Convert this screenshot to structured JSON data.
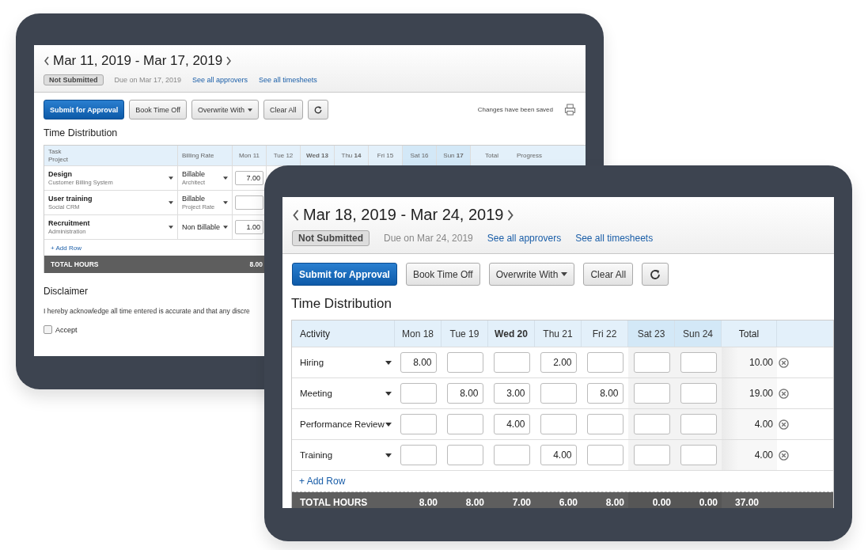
{
  "back_window": {
    "title": "Mar 11, 2019 - Mar 17, 2019",
    "status": "Not Submitted",
    "due": "Due on Mar 17, 2019",
    "links": [
      "See all approvers",
      "See all timesheets"
    ],
    "buttons": [
      {
        "label": "Submit for Approval",
        "kind": "primary"
      },
      {
        "label": "Book Time Off",
        "kind": "plain"
      },
      {
        "label": "Overwrite With",
        "kind": "dropdown"
      },
      {
        "label": "Clear All",
        "kind": "plain"
      },
      {
        "kind": "refresh"
      }
    ],
    "save_status": "Changes have been saved",
    "section_title": "Time Distribution",
    "columns": [
      {
        "label": "Task",
        "sub": "Project",
        "kind": "task"
      },
      {
        "label": "Billing Rate",
        "kind": "rate"
      },
      {
        "label": "Mon 11",
        "kind": "day",
        "weekend": false
      },
      {
        "label": "Tue 12",
        "kind": "day",
        "weekend": false
      },
      {
        "label": "**Wed 13**",
        "kind": "day",
        "weekend": false
      },
      {
        "label": "Thu **14**",
        "kind": "day",
        "weekend": false
      },
      {
        "label": "Fri 15",
        "kind": "day",
        "weekend": false
      },
      {
        "label": "Sat 16",
        "kind": "day",
        "weekend": true
      },
      {
        "label": "Sun **17**",
        "kind": "day",
        "weekend": true
      },
      {
        "label": "Total",
        "kind": "total"
      },
      {
        "label": "Progress",
        "kind": "progress"
      }
    ],
    "rows": [
      {
        "task": "Design",
        "project": "Customer Billing System",
        "rate": "Billable",
        "rate_detail": "Architect",
        "mon": "7.00"
      },
      {
        "task": "User training",
        "project": "Social CRM",
        "rate": "Billable",
        "rate_detail": "Project Rate"
      },
      {
        "task": "Recruitment",
        "project": "Administration",
        "rate": "Non Billable",
        "mon": "1.00"
      }
    ],
    "add_row": "+ Add Row",
    "total_label": "TOTAL HOURS",
    "total_mon": "8.00",
    "disclaimer_title": "Disclaimer",
    "disclaimer_text": "I hereby acknowledge all time entered is accurate and that any discre",
    "accept": {
      "label": "Accept",
      "checked": false
    }
  },
  "front_window": {
    "title": "Mar 18, 2019 - Mar 24, 2019",
    "status": "Not Submitted",
    "due": "Due on Mar 24, 2019",
    "links": [
      "See all approvers",
      "See all timesheets"
    ],
    "buttons": [
      {
        "label": "Submit for Approval",
        "kind": "primary"
      },
      {
        "label": "Book Time Off",
        "kind": "plain"
      },
      {
        "label": "Overwrite With",
        "kind": "dropdown"
      },
      {
        "label": "Clear All",
        "kind": "plain"
      },
      {
        "kind": "refresh"
      }
    ],
    "section_title": "Time Distribution",
    "activity_header": "Activity",
    "days": [
      {
        "label": "Mon 18",
        "today": false,
        "weekend": false
      },
      {
        "label": "Tue 19",
        "today": false,
        "weekend": false
      },
      {
        "label": "Wed 20",
        "today": true,
        "weekend": false
      },
      {
        "label": "Thu 21",
        "today": false,
        "weekend": false
      },
      {
        "label": "Fri 22",
        "today": false,
        "weekend": false
      },
      {
        "label": "Sat 23",
        "today": false,
        "weekend": true
      },
      {
        "label": "Sun 24",
        "today": false,
        "weekend": true
      }
    ],
    "total_header": "Total",
    "rows": [
      {
        "activity": "Hiring",
        "hours": {
          "mon": "8.00",
          "thu": "2.00"
        },
        "total": "10.00"
      },
      {
        "activity": "Meeting",
        "hours": {
          "tue": "8.00",
          "wed": "3.00",
          "fri": "8.00"
        },
        "total": "19.00"
      },
      {
        "activity": "Performance Review",
        "hours": {
          "wed": "4.00"
        },
        "total": "4.00"
      },
      {
        "activity": "Training",
        "hours": {
          "thu": "4.00"
        },
        "total": "4.00"
      }
    ],
    "add_row": "+ Add Row",
    "total_label": "TOTAL HOURS",
    "day_totals": [
      "8.00",
      "8.00",
      "7.00",
      "6.00",
      "8.00",
      "0.00",
      "0.00"
    ],
    "grand_total": "37.00"
  }
}
